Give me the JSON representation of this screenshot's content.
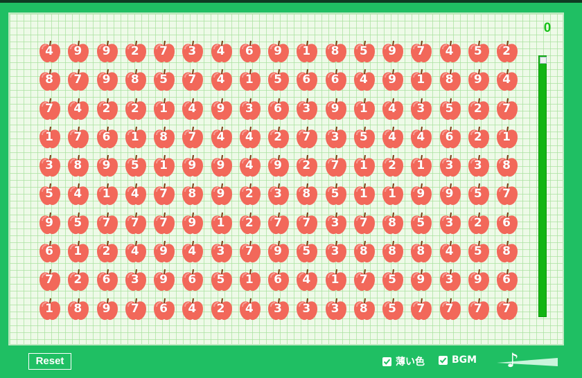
{
  "game": {
    "score": "0",
    "time_remaining_fraction": 1.0,
    "grid": [
      [
        4,
        9,
        9,
        2,
        7,
        3,
        4,
        6,
        9,
        1,
        8,
        5,
        9,
        7,
        4,
        5,
        2
      ],
      [
        8,
        7,
        9,
        8,
        5,
        7,
        4,
        1,
        5,
        6,
        6,
        4,
        9,
        1,
        8,
        9,
        4
      ],
      [
        7,
        4,
        2,
        2,
        1,
        4,
        9,
        3,
        6,
        3,
        9,
        1,
        4,
        3,
        5,
        2,
        7
      ],
      [
        1,
        7,
        6,
        1,
        8,
        7,
        4,
        4,
        2,
        7,
        3,
        5,
        4,
        4,
        6,
        2,
        1
      ],
      [
        3,
        8,
        9,
        5,
        1,
        9,
        9,
        4,
        9,
        2,
        7,
        1,
        2,
        1,
        3,
        3,
        8
      ],
      [
        5,
        4,
        1,
        4,
        7,
        8,
        9,
        2,
        3,
        8,
        5,
        1,
        1,
        9,
        9,
        5,
        7
      ],
      [
        9,
        5,
        7,
        7,
        7,
        9,
        1,
        2,
        7,
        7,
        3,
        7,
        8,
        5,
        3,
        2,
        6
      ],
      [
        6,
        1,
        2,
        4,
        9,
        4,
        3,
        7,
        9,
        5,
        3,
        8,
        8,
        8,
        4,
        5,
        8
      ],
      [
        7,
        2,
        6,
        3,
        9,
        6,
        5,
        1,
        6,
        4,
        1,
        7,
        5,
        9,
        3,
        9,
        6
      ],
      [
        1,
        8,
        9,
        7,
        6,
        4,
        2,
        4,
        3,
        3,
        3,
        8,
        5,
        7,
        7,
        7,
        7
      ]
    ]
  },
  "controls": {
    "reset_label": "Reset",
    "light_color_label": "薄い色",
    "light_color_checked": true,
    "bgm_label": "BGM",
    "bgm_checked": true,
    "volume_icon": "music-note-icon"
  },
  "colors": {
    "frame": "#1fbf63",
    "apple": "#f2685a",
    "score": "#16c216",
    "timer": "#13b513"
  }
}
